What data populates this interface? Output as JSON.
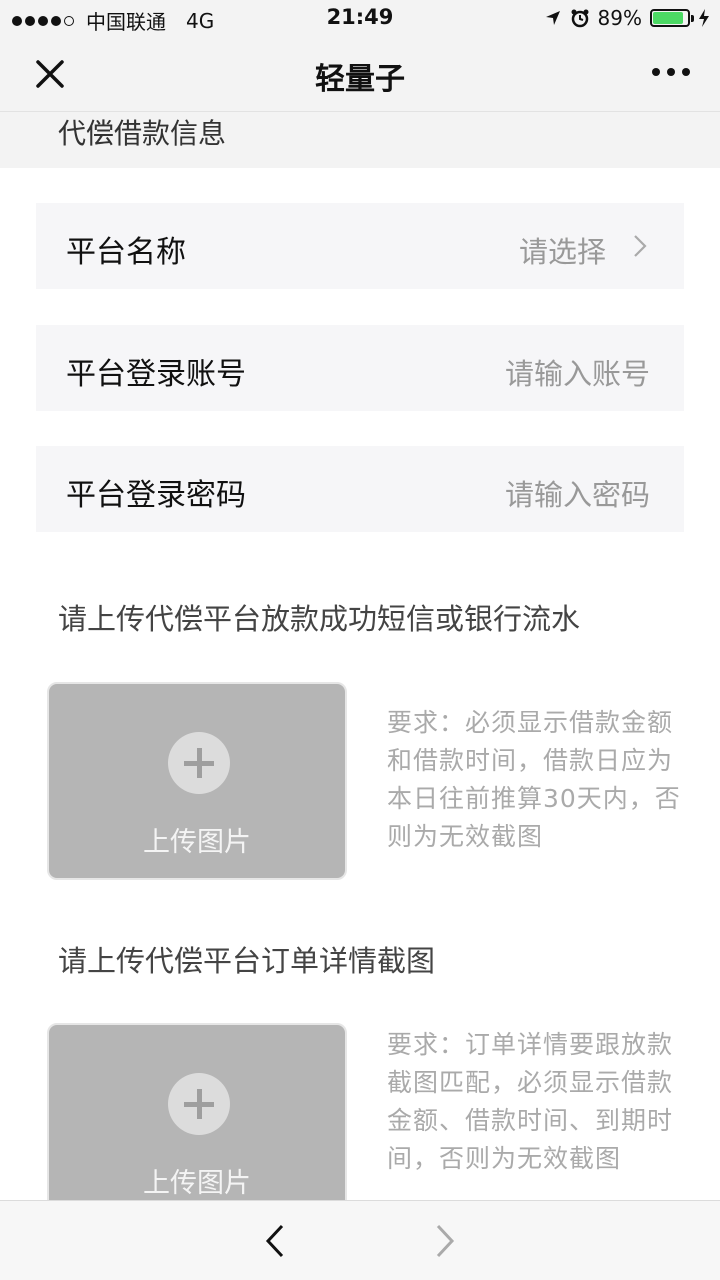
{
  "status_bar": {
    "carrier": "中国联通",
    "network": "4G",
    "time": "21:49",
    "battery_percent": "89%",
    "battery_level": 0.89,
    "battery_color": "#4cd964"
  },
  "nav": {
    "title": "轻量子",
    "close_icon": "close-icon",
    "more_icon": "more-dots-icon"
  },
  "section": {
    "title": "代偿借款信息"
  },
  "form": {
    "platform_name": {
      "label": "平台名称",
      "value": "请选择"
    },
    "account": {
      "label": "平台登录账号",
      "placeholder": "请输入账号"
    },
    "password": {
      "label": "平台登录密码",
      "placeholder": "请输入密码"
    }
  },
  "uploads": [
    {
      "title": "请上传代偿平台放款成功短信或银行流水",
      "button_label": "上传图片",
      "requirement": "要求：必须显示借款金额和借款时间，借款日应为本日往前推算30天内，否则为无效截图"
    },
    {
      "title": "请上传代偿平台订单详情截图",
      "button_label": "上传图片",
      "requirement": "要求：订单详情要跟放款截图匹配，必须显示借款金额、借款时间、到期时间，否则为无效截图"
    }
  ],
  "toolbar": {
    "back_icon": "chevron-left-icon",
    "forward_icon": "chevron-right-icon"
  }
}
